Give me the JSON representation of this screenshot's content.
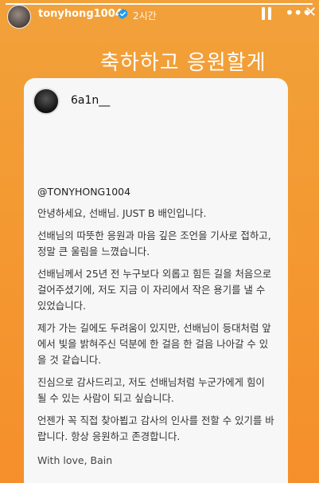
{
  "story": {
    "username": "tonyhong1004",
    "time_ago": "2시간",
    "progress_fraction": 1.0,
    "headline": "축하하고 응원할게"
  },
  "shared_post": {
    "username": "6a1n__",
    "mention": "@TONYHONG1004",
    "paragraphs": [
      "안녕하세요, 선배님. JUST B 배인입니다.",
      "선배님의 따뜻한 응원과 마음 깊은 조언을 기사로 접하고, 정말 큰 울림을 느꼈습니다.",
      "선배님께서 25년 전 누구보다 외롭고 힘든 길을 처음으로 걸어주셨기에, 저도 지금 이 자리에서 작은 용기를 낼 수 있었습니다.",
      "제가 가는 길에도 두려움이 있지만, 선배님이 등대처럼 앞에서 빛을 밝혀주신 덕분에 한 걸음 한 걸음 나아갈 수 있을 것 같습니다.",
      "진심으로 감사드리고, 저도 선배님처럼 누군가에게 힘이 될 수 있는 사람이 되고 싶습니다.",
      "언젠가 꼭 직접 찾아뵙고 감사의 인사를 전할 수 있기를 바랍니다. 항상 응원하고 존경합니다."
    ],
    "signoff": "With love, Bain"
  },
  "icons": {
    "verified": "verified-badge-icon",
    "pause": "pause-icon",
    "more": "more-options-icon",
    "close": "close-icon"
  },
  "colors": {
    "background_top": "#f2a13a",
    "background_bottom": "#f58f2c",
    "card": "#f7f7f7",
    "verified_blue": "#1d9bf0"
  }
}
